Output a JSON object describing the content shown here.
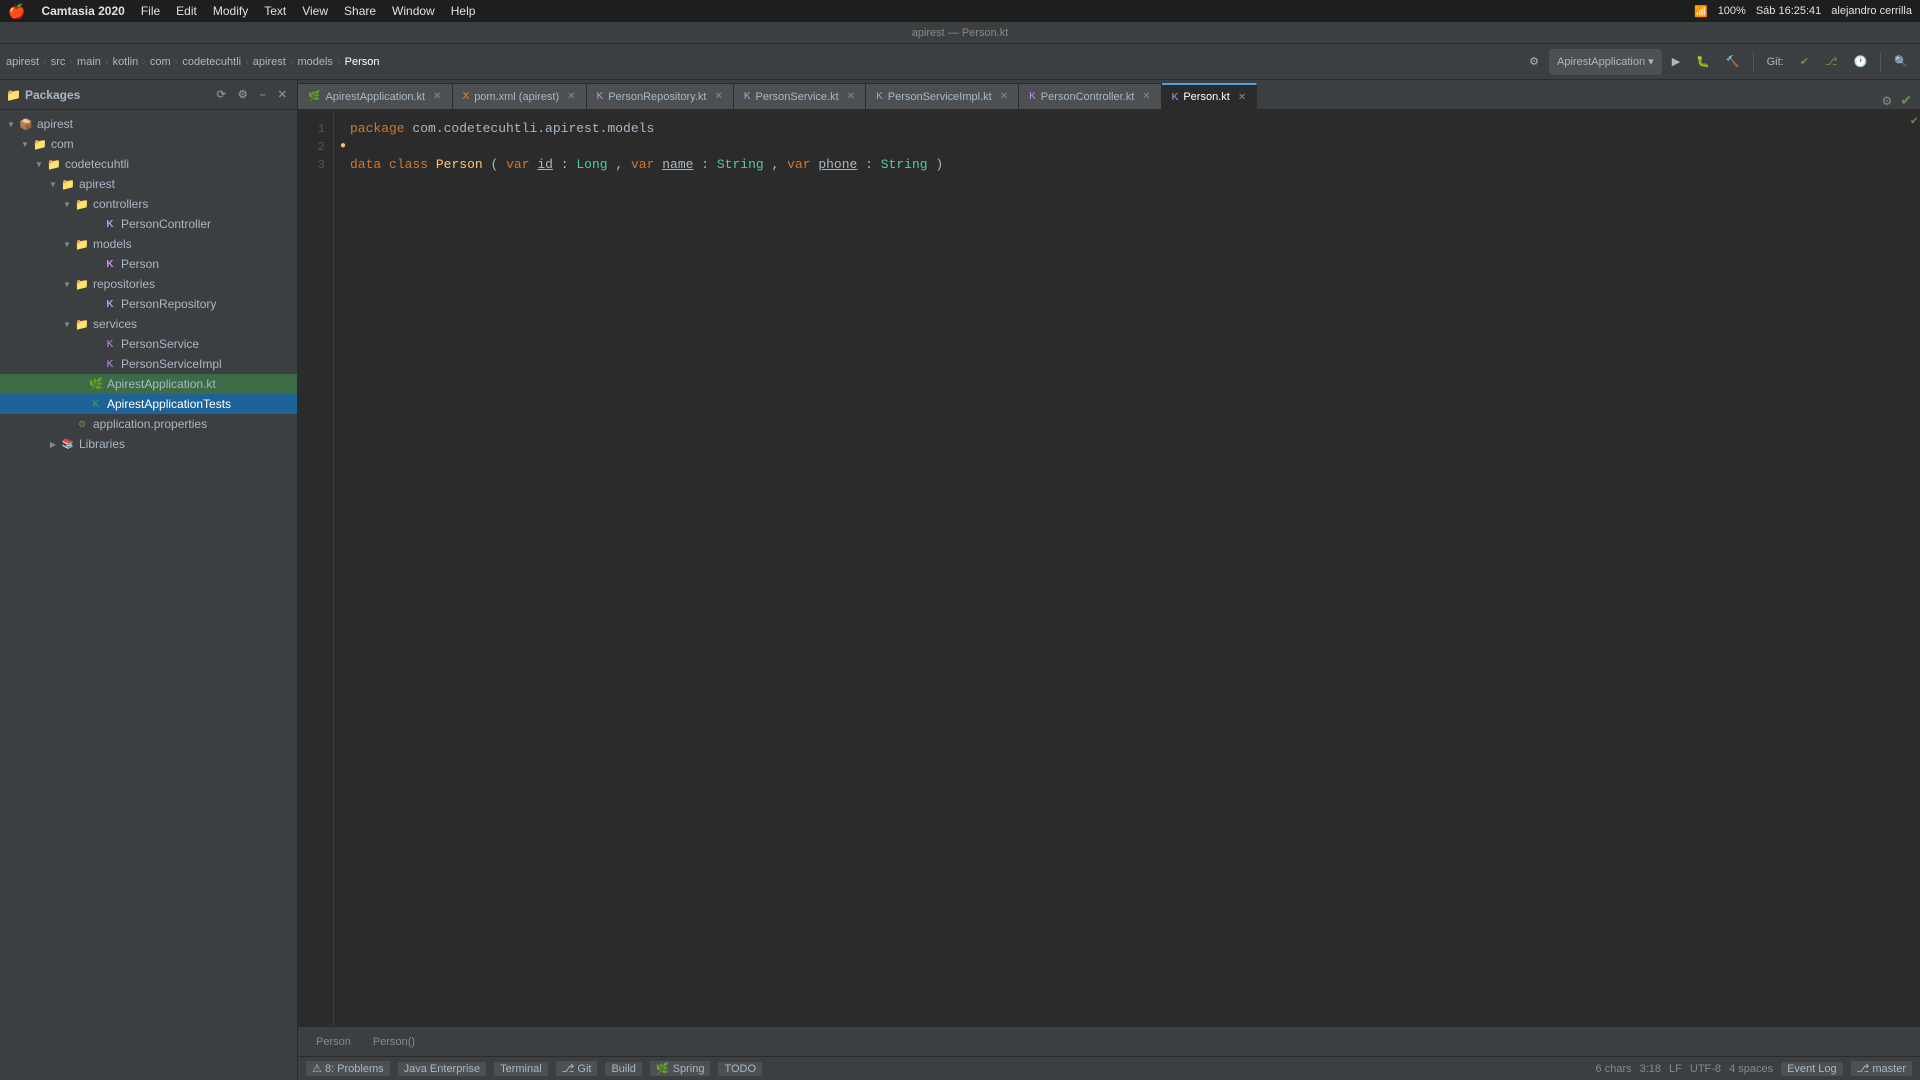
{
  "menubar": {
    "apple": "🍎",
    "app_name": "Camtasia 2020",
    "menus": [
      "File",
      "Edit",
      "Modify",
      "Text",
      "View",
      "Share",
      "Window",
      "Help"
    ],
    "right": {
      "battery": "100%",
      "wifi": "WiFi",
      "time": "Sáb 16:25:41",
      "user": "alejandro cerrilla"
    }
  },
  "titlebar": {
    "text": "apirest — Person.kt"
  },
  "toolbar": {
    "run_config": "ApirestApplication ▾",
    "breadcrumb_items": [
      "apirest",
      "src",
      "main",
      "kotlin",
      "com",
      "codetecuhtli",
      "apirest",
      "models",
      "Person"
    ]
  },
  "tabs": [
    {
      "label": "ApirestApplication.kt",
      "active": false,
      "icon": "K"
    },
    {
      "label": "pom.xml (apirest)",
      "active": false,
      "icon": "X"
    },
    {
      "label": "PersonRepository.kt",
      "active": false,
      "icon": "K"
    },
    {
      "label": "PersonService.kt",
      "active": false,
      "icon": "K"
    },
    {
      "label": "PersonServiceImpl.kt",
      "active": false,
      "icon": "K"
    },
    {
      "label": "PersonController.kt",
      "active": false,
      "icon": "K"
    },
    {
      "label": "Person.kt",
      "active": true,
      "icon": "K"
    }
  ],
  "tree": {
    "items": [
      {
        "label": "Packages",
        "indent": 0,
        "type": "header",
        "arrow": "none"
      },
      {
        "label": "apirest",
        "indent": 1,
        "type": "folder-blue",
        "arrow": "open"
      },
      {
        "label": "com",
        "indent": 2,
        "type": "folder",
        "arrow": "open"
      },
      {
        "label": "codetecuhtli",
        "indent": 3,
        "type": "folder",
        "arrow": "open"
      },
      {
        "label": "apirest",
        "indent": 4,
        "type": "folder",
        "arrow": "open"
      },
      {
        "label": "controllers",
        "indent": 5,
        "type": "folder",
        "arrow": "open"
      },
      {
        "label": "PersonController",
        "indent": 6,
        "type": "kt",
        "arrow": "none"
      },
      {
        "label": "models",
        "indent": 5,
        "type": "folder",
        "arrow": "open"
      },
      {
        "label": "Person",
        "indent": 6,
        "type": "kt",
        "arrow": "none"
      },
      {
        "label": "repositories",
        "indent": 5,
        "type": "folder",
        "arrow": "open"
      },
      {
        "label": "PersonRepository",
        "indent": 6,
        "type": "kt",
        "arrow": "none"
      },
      {
        "label": "services",
        "indent": 5,
        "type": "folder",
        "arrow": "open"
      },
      {
        "label": "PersonService",
        "indent": 6,
        "type": "kt-interface",
        "arrow": "none"
      },
      {
        "label": "PersonServiceImpl",
        "indent": 6,
        "type": "kt-impl",
        "arrow": "none"
      },
      {
        "label": "ApirestApplication.kt",
        "indent": 5,
        "type": "kt",
        "arrow": "none",
        "selected": false,
        "highlighted": true
      },
      {
        "label": "ApirestApplicationTests",
        "indent": 5,
        "type": "kt-test",
        "arrow": "none",
        "selected": true
      },
      {
        "label": "application.properties",
        "indent": 4,
        "type": "properties",
        "arrow": "none"
      },
      {
        "label": "Libraries",
        "indent": 3,
        "type": "folder-lib",
        "arrow": "closed"
      }
    ]
  },
  "editor": {
    "lines": [
      {
        "num": "1",
        "content": "package",
        "type": "package"
      },
      {
        "num": "2",
        "content": "",
        "type": "blank"
      },
      {
        "num": "3",
        "content": "data class Person(var id: Long, var name: String, var phone: String)",
        "type": "code"
      }
    ],
    "code_line1": "package com.codetecuhtli.apirest.models",
    "code_line2": "",
    "code_line3_parts": {
      "keyword": "data class ",
      "classname": "Person",
      "paren_open": "(",
      "var1": "var ",
      "param1": "id",
      "colon1": ": ",
      "type1": "Long",
      "comma1": ", ",
      "var2": "var ",
      "param2": "name",
      "colon2": ": ",
      "type2": "String",
      "comma2": ", ",
      "var3": "var ",
      "param3": "phone",
      "colon3": ": ",
      "type3": "String",
      "paren_close": ")"
    }
  },
  "bottom_tabs": [
    {
      "label": "Person",
      "active": false
    },
    {
      "label": "Person()",
      "active": false
    }
  ],
  "statusbar": {
    "problems": "⚠ 8: Problems",
    "java_enterprise": "Java Enterprise",
    "terminal": "Terminal",
    "git": "⎇ Git",
    "build": "Build",
    "spring": "Spring",
    "todo": "TODO",
    "chars": "6 chars",
    "pos": "3:18",
    "encoding": "LF",
    "charset": "UTF-8",
    "indent": "4 spaces",
    "event_log": "Event Log",
    "branch": "⎇ master"
  }
}
